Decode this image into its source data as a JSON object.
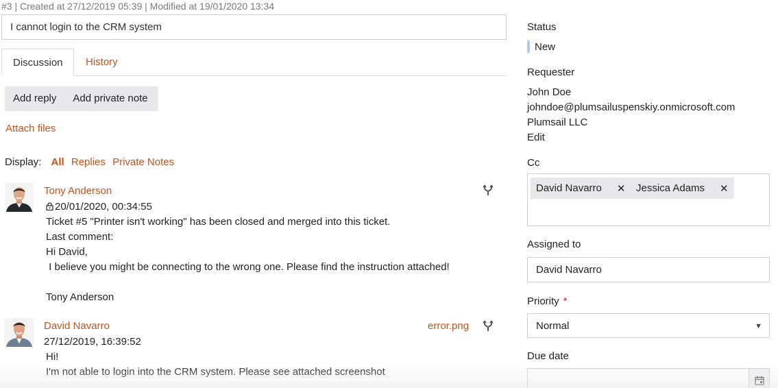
{
  "ticket": {
    "meta": "#3 | Created at 27/12/2019 05:39 | Modified at 19/01/2020 13:34",
    "subject": "I cannot login to the CRM system"
  },
  "tabs": [
    {
      "label": "Discussion",
      "active": true
    },
    {
      "label": "History",
      "active": false
    }
  ],
  "actions": {
    "add_reply": "Add reply",
    "add_private_note": "Add private note",
    "attach_files": "Attach files"
  },
  "display_filter": {
    "label": "Display:",
    "options": [
      "All",
      "Replies",
      "Private Notes"
    ],
    "selected": "All"
  },
  "comments": [
    {
      "author": "Tony Anderson",
      "date": "20/01/2020, 00:34:55",
      "private": true,
      "icon": "lock-icon",
      "lines": [
        "Ticket #5 \"Printer isn't working\" has been closed and merged into this ticket.",
        "Last comment:",
        "Hi David,",
        " I believe you might be connecting to the wrong one. Please find the instruction attached!",
        "",
        "Tony Anderson"
      ]
    },
    {
      "author": "David Navarro",
      "date": "27/12/2019, 16:39:52",
      "private": false,
      "attachment": "error.png",
      "lines": [
        "Hi!",
        "I'm not able to login into the CRM system. Please see attached screenshot"
      ]
    }
  ],
  "sidebar": {
    "status": {
      "label": "Status",
      "value": "New",
      "color": "#a9cdf0"
    },
    "requester": {
      "label": "Requester",
      "name": "John Doe",
      "email": "johndoe@plumsailuspenskiy.onmicrosoft.com",
      "company": "Plumsail LLC",
      "edit": "Edit"
    },
    "cc": {
      "label": "Cc",
      "people": [
        "David Navarro",
        "Jessica Adams"
      ]
    },
    "assigned_to": {
      "label": "Assigned to",
      "value": "David Navarro"
    },
    "priority": {
      "label": "Priority",
      "required_mark": "*",
      "value": "Normal"
    },
    "due_date": {
      "label": "Due date",
      "value": ""
    }
  },
  "colors": {
    "accent": "#c8511b",
    "button_bg": "#e6e8eb",
    "border": "#cfcfcf"
  }
}
